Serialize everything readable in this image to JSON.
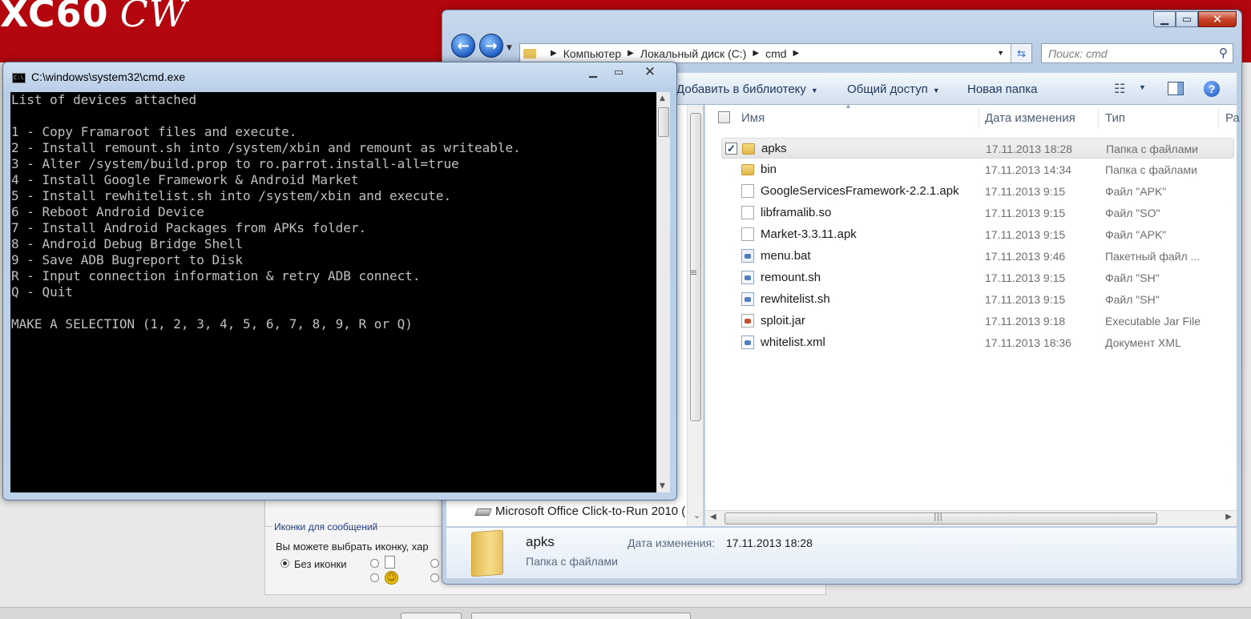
{
  "background": {
    "logo": {
      "text": "XC60",
      "script": "CW"
    },
    "fieldset_legend": "Иконки для сообщений",
    "hint": "Вы можете выбрать иконку, хар",
    "no_icon_label": "Без иконки"
  },
  "cmd": {
    "title": "C:\\windows\\system32\\cmd.exe",
    "lines": [
      "List of devices attached",
      "",
      "1 - Copy Framaroot files and execute.",
      "2 - Install remount.sh into /system/xbin and remount as writeable.",
      "3 - Alter /system/build.prop to ro.parrot.install-all=true",
      "4 - Install Google Framework & Android Market",
      "5 - Install rewhitelist.sh into /system/xbin and execute.",
      "6 - Reboot Android Device",
      "7 - Install Android Packages from APKs folder.",
      "8 - Android Debug Bridge Shell",
      "9 - Save ADB Bugreport to Disk",
      "R - Input connection information & retry ADB connect.",
      "Q - Quit",
      "",
      "MAKE A SELECTION (1, 2, 3, 4, 5, 6, 7, 8, 9, R or Q)"
    ]
  },
  "explorer": {
    "breadcrumb": [
      "Компьютер",
      "Локальный диск (C:)",
      "cmd"
    ],
    "search_placeholder": "Поиск: cmd",
    "toolbar": {
      "add_to_library": "Добавить в библиотеку",
      "share": "Общий доступ",
      "new_folder": "Новая папка"
    },
    "columns": {
      "name": "Имя",
      "date": "Дата изменения",
      "type": "Тип",
      "size": "Ра"
    },
    "files": [
      {
        "name": "apks",
        "date": "17.11.2013 18:28",
        "type": "Папка с файлами",
        "icon": "folder-icon",
        "selected": true
      },
      {
        "name": "bin",
        "date": "17.11.2013 14:34",
        "type": "Папка с файлами",
        "icon": "folder-icon",
        "selected": false
      },
      {
        "name": "GoogleServicesFramework-2.2.1.apk",
        "date": "17.11.2013 9:15",
        "type": "Файл \"APK\"",
        "icon": "file-icon",
        "selected": false
      },
      {
        "name": "libframalib.so",
        "date": "17.11.2013 9:15",
        "type": "Файл \"SO\"",
        "icon": "file-icon",
        "selected": false
      },
      {
        "name": "Market-3.3.11.apk",
        "date": "17.11.2013 9:15",
        "type": "Файл \"APK\"",
        "icon": "file-icon",
        "selected": false
      },
      {
        "name": "menu.bat",
        "date": "17.11.2013 9:46",
        "type": "Пакетный файл ...",
        "icon": "batch-file-icon",
        "selected": false
      },
      {
        "name": "remount.sh",
        "date": "17.11.2013 9:15",
        "type": "Файл \"SH\"",
        "icon": "script-file-icon",
        "selected": false
      },
      {
        "name": "rewhitelist.sh",
        "date": "17.11.2013 9:15",
        "type": "Файл \"SH\"",
        "icon": "script-file-icon",
        "selected": false
      },
      {
        "name": "sploit.jar",
        "date": "17.11.2013 9:18",
        "type": "Executable Jar File",
        "icon": "jar-file-icon",
        "selected": false
      },
      {
        "name": "whitelist.xml",
        "date": "17.11.2013 18:36",
        "type": "Документ XML",
        "icon": "xml-file-icon",
        "selected": false
      }
    ],
    "nav_item": "Microsoft Office Click-to-Run 2010 (",
    "details": {
      "name": "apks",
      "type": "Папка с файлами",
      "date_label": "Дата изменения:",
      "date_value": "17.11.2013 18:28"
    }
  }
}
